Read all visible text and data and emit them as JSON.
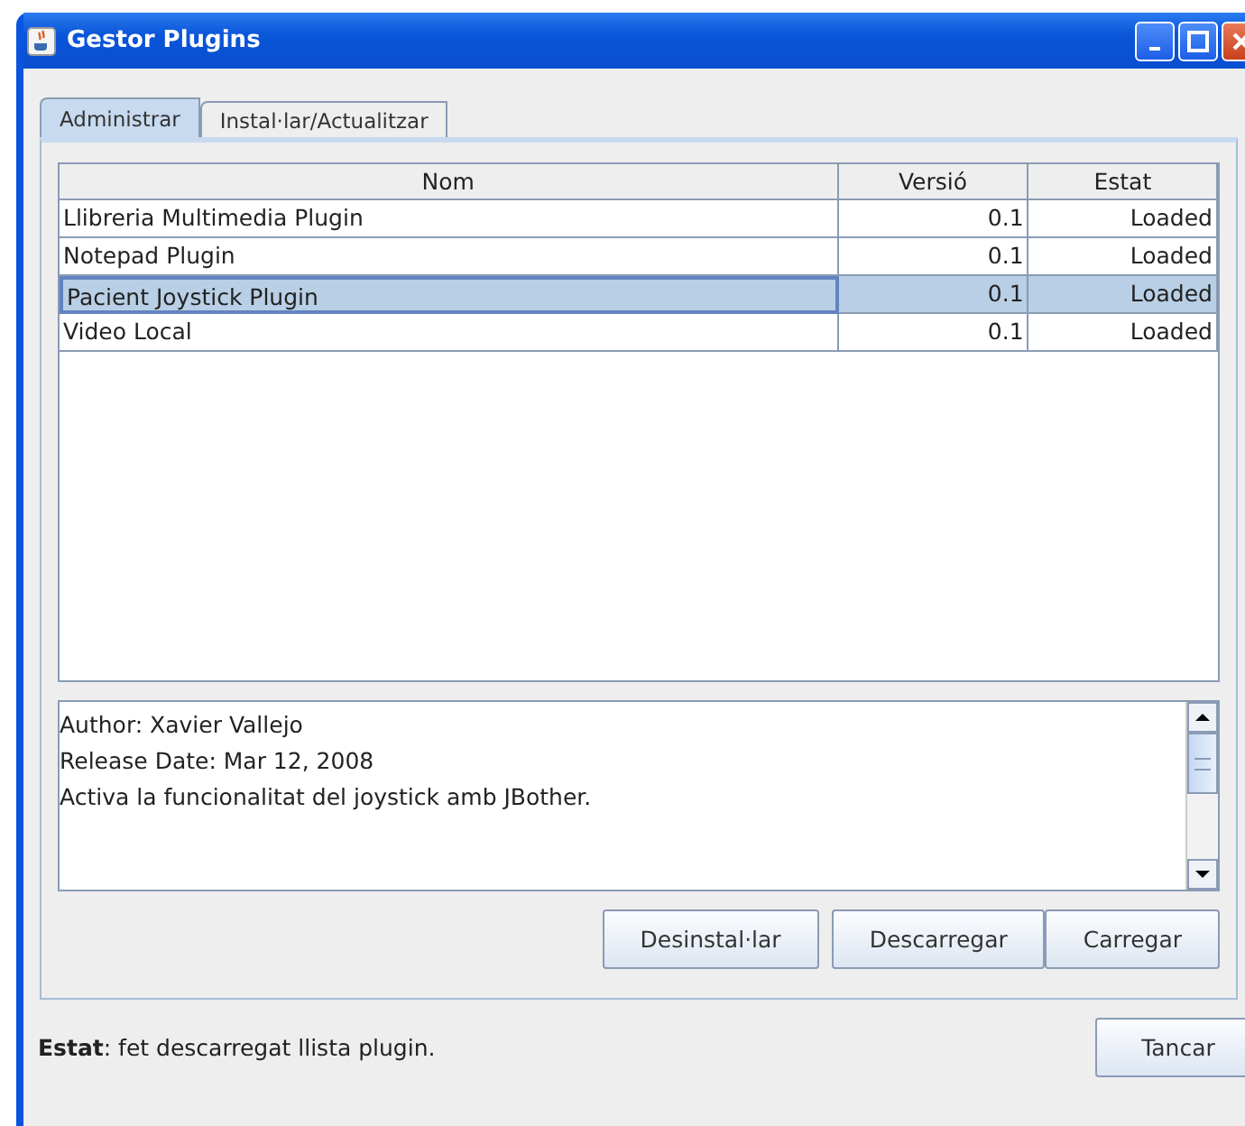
{
  "window": {
    "title": "Gestor Plugins"
  },
  "tabs": [
    {
      "label": "Administrar",
      "selected": true
    },
    {
      "label": "Instal·lar/Actualitzar",
      "selected": false
    }
  ],
  "table": {
    "columns": [
      "Nom",
      "Versió",
      "Estat"
    ],
    "rows": [
      {
        "cells": [
          "Llibreria Multimedia Plugin",
          "0.1",
          "Loaded"
        ],
        "selected": false
      },
      {
        "cells": [
          "Notepad Plugin",
          "0.1",
          "Loaded"
        ],
        "selected": false
      },
      {
        "cells": [
          "Pacient Joystick Plugin",
          "0.1",
          "Loaded"
        ],
        "selected": true
      },
      {
        "cells": [
          "Video Local",
          "0.1",
          "Loaded"
        ],
        "selected": false
      }
    ]
  },
  "details": [
    "Author: Xavier Vallejo",
    "Release Date: Mar 12, 2008",
    "Activa la funcionalitat del joystick amb JBother."
  ],
  "actions": [
    "Desinstal·lar",
    "Descarregar",
    "Carregar"
  ],
  "status_bar": {
    "text": "**Estat**: fet descarregat llista plugin.",
    "button": "Tancar"
  }
}
